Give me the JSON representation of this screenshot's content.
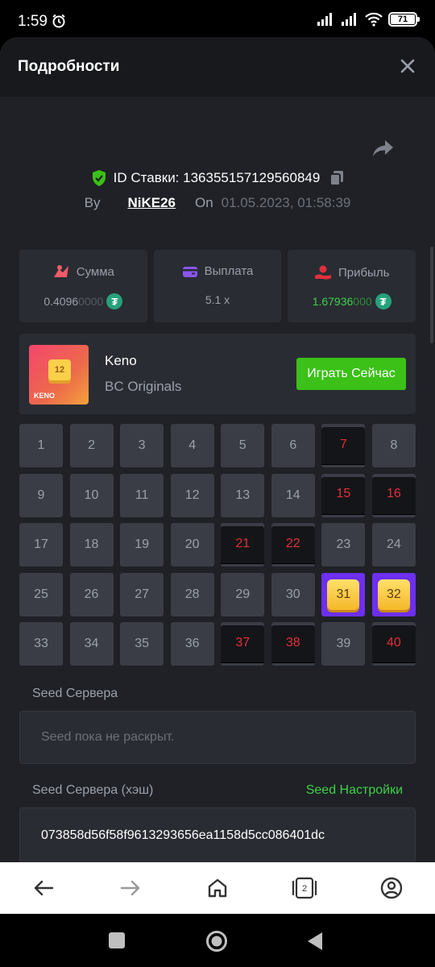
{
  "status": {
    "time": "1:59",
    "battery": "71"
  },
  "header": {
    "title": "Подробности"
  },
  "bet": {
    "id_label": "ID Ставки: ",
    "id_value": "136355157129560849",
    "by_label": "By",
    "user": "NiKE26",
    "on_label": "On",
    "datetime": "01.05.2023, 01:58:39"
  },
  "stats": {
    "amount": {
      "label": "Сумма",
      "value_main": "0.4096",
      "value_dim": "0000"
    },
    "payout": {
      "label": "Выплата",
      "value": "5.1 x"
    },
    "profit": {
      "label": "Прибыль",
      "value_main": "1.67936",
      "value_dim": "000"
    }
  },
  "game": {
    "name": "Keno",
    "provider": "BC Originals",
    "play_label": "Играть Сейчас",
    "thumb_number": "12",
    "thumb_text": "KENO"
  },
  "grid": {
    "numbers": [
      "1",
      "2",
      "3",
      "4",
      "5",
      "6",
      "7",
      "8",
      "9",
      "10",
      "11",
      "12",
      "13",
      "14",
      "15",
      "16",
      "17",
      "18",
      "19",
      "20",
      "21",
      "22",
      "23",
      "24",
      "25",
      "26",
      "27",
      "28",
      "29",
      "30",
      "31",
      "32",
      "33",
      "34",
      "35",
      "36",
      "37",
      "38",
      "39",
      "40"
    ],
    "states": [
      "n",
      "n",
      "n",
      "n",
      "n",
      "n",
      "m",
      "n",
      "n",
      "n",
      "n",
      "n",
      "n",
      "n",
      "m",
      "m",
      "n",
      "n",
      "n",
      "n",
      "m",
      "m",
      "n",
      "n",
      "n",
      "n",
      "n",
      "n",
      "n",
      "n",
      "h",
      "h",
      "n",
      "n",
      "n",
      "n",
      "m",
      "m",
      "n",
      "m"
    ]
  },
  "seed": {
    "server_label": "Seed Сервера",
    "server_placeholder": "Seed пока не раскрыт.",
    "hash_label": "Seed Сервера (хэш)",
    "settings_link": "Seed Настройки",
    "hash_value": "073858d56f58f9613293656ea1158d5cc086401dc"
  },
  "browser_nav": {
    "tabs_count": "2"
  },
  "colors": {
    "accent_green": "#3bc117",
    "miss_red": "#e0303a",
    "hit_purple": "#6d2ff0",
    "background": "#1f2126"
  }
}
